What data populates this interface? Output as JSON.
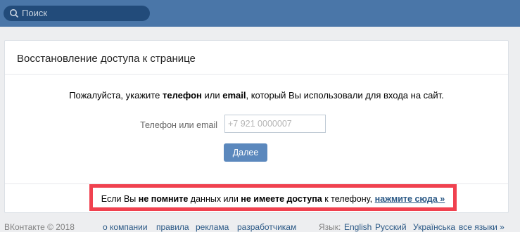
{
  "header": {
    "search_placeholder": "Поиск"
  },
  "card": {
    "title": "Восстановление доступа к странице",
    "instruction": {
      "part1": "Пожалуйста, укажите ",
      "bold1": "телефон",
      "part2": " или ",
      "bold2": "email",
      "part3": ", который Вы использовали для входа на сайт."
    },
    "phone_label": "Телефон или email",
    "phone_placeholder": "+7 921 0000007",
    "next_button": "Далее"
  },
  "notice": {
    "part1": "Если Вы ",
    "bold1": "не помните",
    "part2": " данных или ",
    "bold2": "не имеете доступа",
    "part3": " к телефону, ",
    "link": "нажмите сюда »"
  },
  "footer": {
    "copyright": "ВКонтакте © 2018",
    "links": [
      "о компании",
      "правила",
      "реклама",
      "разработчикам"
    ],
    "language_label": "Язык:",
    "languages": [
      "English",
      "Русский",
      "Українська",
      "все языки »"
    ]
  },
  "colors": {
    "header_bg": "#4a76a8",
    "accent_button": "#5b88bd",
    "highlight_border": "#f0414f"
  }
}
